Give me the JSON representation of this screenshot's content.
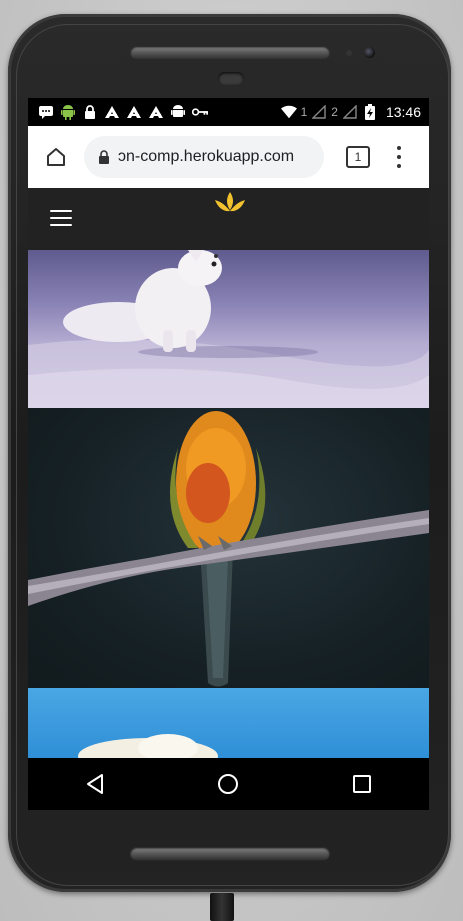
{
  "status_bar": {
    "sim1_label": "1",
    "sim2_label": "2",
    "time": "13:46"
  },
  "browser": {
    "url": "ɔn-comp.herokuapp.com",
    "tab_count": "1"
  },
  "icons": {
    "home": "home-icon",
    "lock": "lock-icon",
    "menu": "more-vert-icon",
    "hamburger": "hamburger-menu-icon",
    "logo": "lotus-logo-icon",
    "back": "back-triangle-icon",
    "home_nav": "home-circle-icon",
    "recents": "recents-square-icon"
  },
  "colors": {
    "app_bar": "#222222",
    "logo": "#f2c12e",
    "screen_bg": "#000000"
  }
}
